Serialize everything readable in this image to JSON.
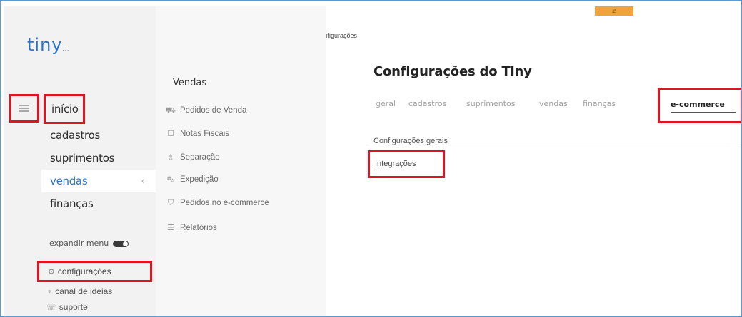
{
  "app": {
    "logo": "tiny",
    "logo_suffix": "..."
  },
  "sidebar": {
    "items": [
      {
        "label": "início"
      },
      {
        "label": "cadastros"
      },
      {
        "label": "suprimentos"
      },
      {
        "label": "vendas",
        "arrow": "‹"
      },
      {
        "label": "finanças"
      }
    ],
    "expand_label": "expandir menu",
    "settings_label": "configurações",
    "ideas_label": "canal de ideias",
    "support_label": "suporte"
  },
  "submenu": {
    "title": "Vendas",
    "items": [
      {
        "icon": "cart-icon",
        "label": "Pedidos de Venda"
      },
      {
        "icon": "invoice-icon",
        "label": "Notas Fiscais"
      },
      {
        "icon": "box-icon",
        "label": "Separação"
      },
      {
        "icon": "truck-icon",
        "label": "Expedição"
      },
      {
        "icon": "store-icon",
        "label": "Pedidos no e-commerce"
      },
      {
        "icon": "report-icon",
        "label": "Relatórios"
      }
    ]
  },
  "main": {
    "breadcrumb": "ıfigurações",
    "badge": "ℤ",
    "title": "Configurações do Tiny",
    "tabs": [
      "geral",
      "cadastros",
      "suprimentos",
      "vendas",
      "finanças"
    ],
    "active_tab": "e-commerce",
    "section_label": "Configurações gerais",
    "integrations_label": "Integrações"
  },
  "colors": {
    "accent": "#2a73c8",
    "highlight": "#e0141e"
  }
}
